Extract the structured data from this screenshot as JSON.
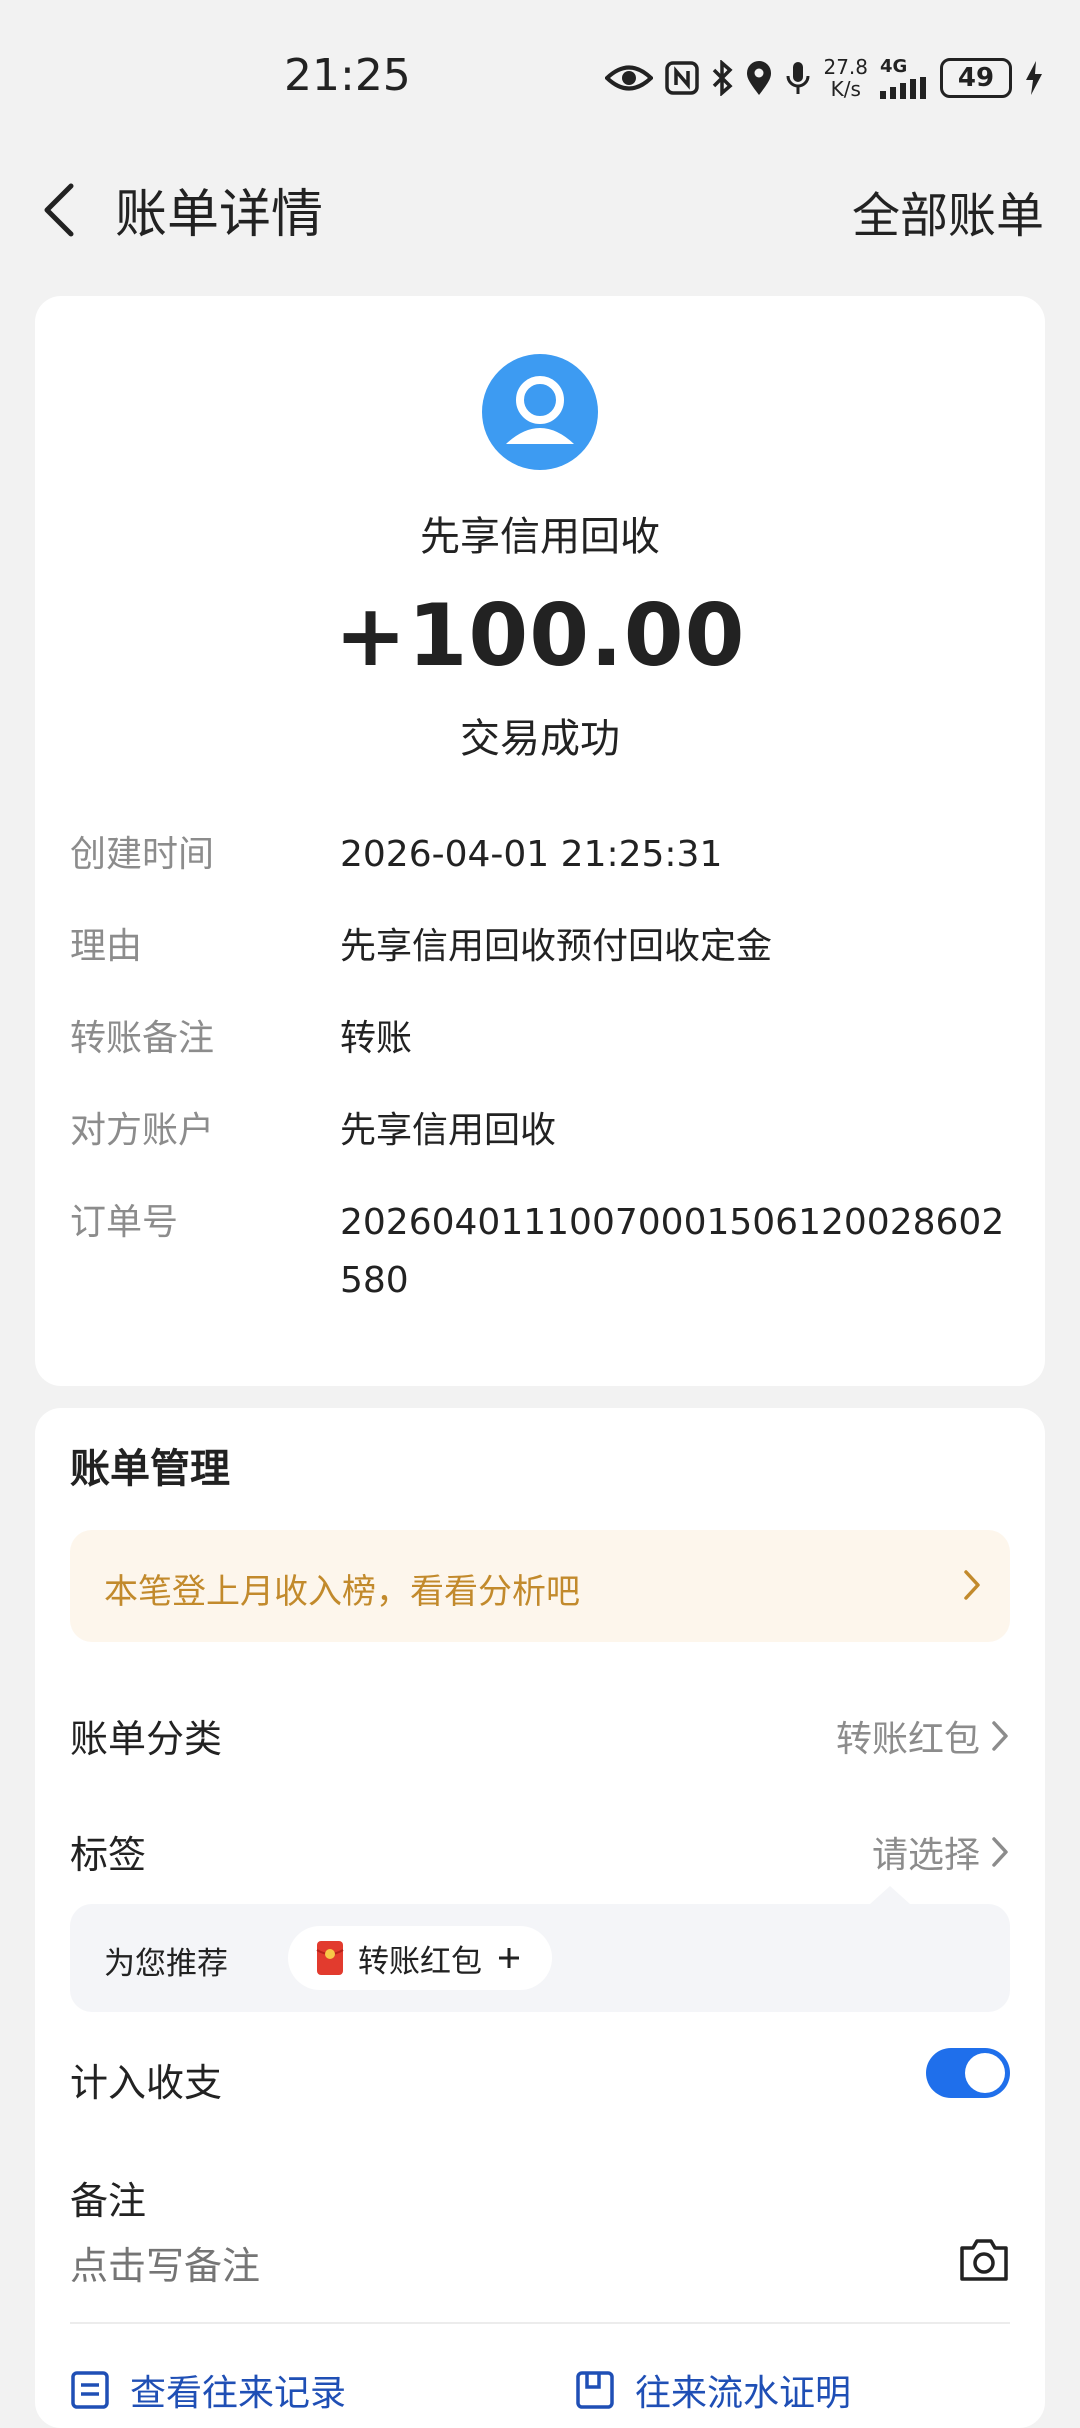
{
  "status_bar": {
    "time": "21:25",
    "net_speed_value": "27.8",
    "net_speed_unit": "K/s",
    "network_type": "4G",
    "battery": "49"
  },
  "nav": {
    "title": "账单详情",
    "right_link": "全部账单"
  },
  "transaction": {
    "payer": "先享信用回收",
    "amount": "+100.00",
    "status": "交易成功",
    "details": [
      {
        "label": "创建时间",
        "value": "2026-04-01 21:25:31"
      },
      {
        "label": "理由",
        "value": "先享信用回收预付回收定金"
      },
      {
        "label": "转账备注",
        "value": "转账"
      },
      {
        "label": "对方账户",
        "value": "先享信用回收"
      },
      {
        "label": "订单号",
        "value": "20260401110070001506120028602580"
      }
    ]
  },
  "manage": {
    "title": "账单管理",
    "promo_text": "本笔登上月收入榜，看看分析吧",
    "category_label": "账单分类",
    "category_value": "转账红包",
    "tag_label": "标签",
    "tag_value": "请选择",
    "recommend_label": "为您推荐",
    "recommend_chip": "转账红包",
    "count_label": "计入收支",
    "count_enabled": true,
    "note_label": "备注",
    "note_placeholder": "点击写备注",
    "footer_left": "查看往来记录",
    "footer_right": "往来流水证明"
  },
  "colors": {
    "accent": "#1f6feb",
    "avatar": "#3d9bf2",
    "promo_bg": "#fdf6ec",
    "promo_text": "#c28a2c",
    "label_gray": "#8c8c8c"
  }
}
